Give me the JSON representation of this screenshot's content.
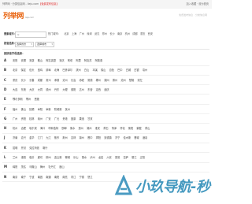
{
  "topbar": {
    "left_prefix": "列举网 · 分类信息网 - lieju.com",
    "left_highlight": "【免费发布信息】",
    "right": "加入收藏 · 设为首页"
  },
  "header": {
    "logo": "列举网",
    "logo_sub": "lieju.com",
    "slogan": "免费发布信息 · 分类信息网"
  },
  "search": {
    "label": "搜索城市：",
    "placeholder": "Q",
    "hot_label": "热门城市：",
    "hot": [
      "北京",
      "上海",
      "广州",
      "深圳",
      "武汉",
      "郑州",
      "长沙",
      "南京",
      "杭州",
      "成都",
      "重庆",
      "西安"
    ]
  },
  "filter": {
    "label": "按省选择：",
    "province": "选择省份",
    "city": "选择城市"
  },
  "list_title": "按拼音字母选择：",
  "rows": [
    {
      "letter": "A",
      "cities": [
        "安阳",
        "安顺",
        "安康",
        "鞍山",
        "阿拉善盟",
        "安庆",
        "阿坝",
        "阿里",
        "阿克苏",
        "阿勒泰"
      ]
    },
    {
      "letter": "B",
      "cities": [
        "北京",
        "保定",
        "包头",
        "宝鸡",
        "蚌埠",
        "北海",
        "巴彦淖尔",
        "滨州",
        "白山",
        "本溪",
        "保山",
        "百色",
        "巴中",
        "白城",
        "白银",
        "亳州"
      ]
    },
    {
      "letter": "C",
      "cities": [
        "重庆",
        "长沙",
        "长春",
        "成都",
        "常州",
        "承德",
        "沧州",
        "长治",
        "赤峰",
        "常德",
        "郴州",
        "潮州",
        "滁州",
        "池州",
        "楚雄",
        "崇左"
      ]
    },
    {
      "letter": "D",
      "cities": [
        "大连",
        "东莞",
        "大庆",
        "大同",
        "德州",
        "丹东",
        "大理",
        "德阳",
        "达州",
        "东营",
        "定西",
        "迪庆"
      ]
    },
    {
      "letter": "E",
      "cities": [
        "鄂尔多斯",
        "鄂州",
        "恩施"
      ]
    },
    {
      "letter": "F",
      "cities": [
        "福州",
        "佛山",
        "抚顺",
        "阜阳",
        "阜新",
        "防城港",
        "抚州"
      ]
    },
    {
      "letter": "G",
      "cities": [
        "广州",
        "贵阳",
        "桂林",
        "赣州",
        "广安",
        "广元",
        "贵港",
        "固原",
        "果洛",
        "甘孜"
      ]
    },
    {
      "letter": "H",
      "cities": [
        "杭州",
        "合肥",
        "哈尔滨",
        "海口",
        "呼和浩特",
        "邯郸",
        "衡水",
        "惠州",
        "湖州",
        "淮安",
        "黄石",
        "菏泽",
        "怀化",
        "衡阳",
        "鹤壁",
        "黄山"
      ]
    },
    {
      "letter": "J",
      "cities": [
        "济南",
        "嘉兴",
        "金华",
        "江门",
        "九江",
        "焦作",
        "荆州",
        "吉林",
        "锦州",
        "晋中",
        "揭阳",
        "景德镇",
        "济宁",
        "佳木斯",
        "晋城",
        "酒泉"
      ]
    },
    {
      "letter": "K",
      "cities": [
        "昆明",
        "开封",
        "克拉玛依",
        "喀什"
      ]
    },
    {
      "letter": "L",
      "cities": [
        "兰州",
        "洛阳",
        "临沂",
        "廊坊",
        "柳州",
        "连云港",
        "聊城",
        "乐山",
        "丽水",
        "泸州",
        "龙岩",
        "六安",
        "娄底",
        "拉萨",
        "丽江",
        "辽阳"
      ]
    },
    {
      "letter": "M",
      "cities": [
        "绵阳",
        "茂名",
        "马鞍山",
        "梅州",
        "牡丹江",
        "眉山"
      ]
    },
    {
      "letter": "N",
      "cities": [
        "南京",
        "南宁",
        "宁波",
        "南昌",
        "南通",
        "南阳",
        "南充",
        "内江",
        "宁德",
        "怒江"
      ]
    }
  ],
  "watermark": "小玖导航-秒"
}
